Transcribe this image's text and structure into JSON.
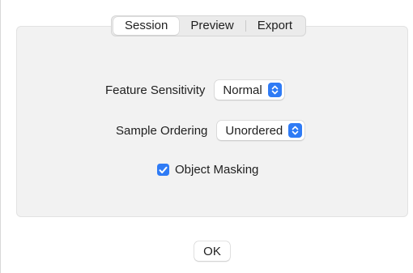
{
  "tabs": [
    {
      "label": "Session",
      "selected": true
    },
    {
      "label": "Preview",
      "selected": false
    },
    {
      "label": "Export",
      "selected": false
    }
  ],
  "settings": {
    "feature_sensitivity": {
      "label": "Feature Sensitivity",
      "value": "Normal"
    },
    "sample_ordering": {
      "label": "Sample Ordering",
      "value": "Unordered"
    },
    "object_masking": {
      "label": "Object Masking",
      "checked": true
    }
  },
  "footer": {
    "ok_label": "OK"
  },
  "colors": {
    "accent": "#2f7bf5",
    "group_background": "#f2f2f2",
    "window_background": "#ffffff"
  },
  "icons": {
    "popup_indicator": "chevron-up-down-icon",
    "checkbox_mark": "checkmark-icon"
  }
}
